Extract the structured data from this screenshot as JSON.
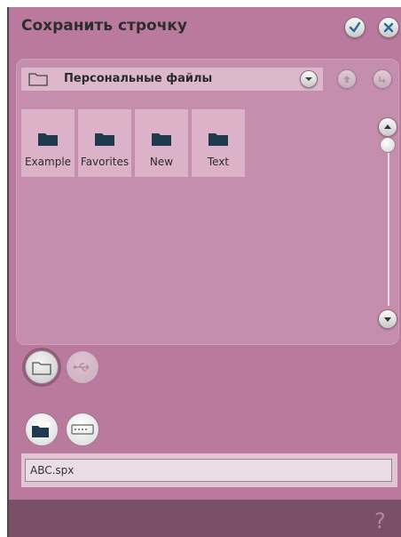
{
  "title": "Сохранить строчку",
  "header": {
    "confirm_icon": "checkmark-icon",
    "close_icon": "close-icon"
  },
  "path_bar": {
    "label": "Персональные файлы",
    "folder_icon": "folder-outline-icon",
    "dropdown_icon": "chevron-down-icon"
  },
  "nav": {
    "up_icon": "folder-up-icon",
    "back_icon": "return-icon"
  },
  "folders": [
    {
      "label": "Example"
    },
    {
      "label": "Favorites"
    },
    {
      "label": "New"
    },
    {
      "label": "Text"
    }
  ],
  "storage": {
    "personal_icon": "folder-outline-icon",
    "usb_icon": "usb-icon"
  },
  "actions": {
    "new_folder_icon": "new-folder-icon",
    "rename_icon": "keyboard-icon"
  },
  "filename": {
    "value": "ABC.spx"
  },
  "footer": {
    "help": "?"
  },
  "colors": {
    "background": "#b97a9e",
    "panel": "#c68ead",
    "tile": "#dcb2c9",
    "footer": "#7a4f68",
    "folder_icon": "#1f3a4f"
  }
}
